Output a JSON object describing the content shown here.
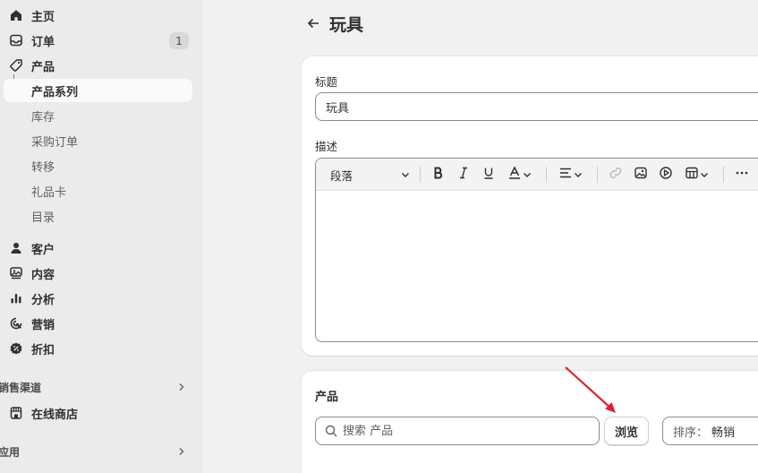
{
  "sidebar": {
    "home": "主页",
    "orders": "订单",
    "orders_badge": "1",
    "products": "产品",
    "collections": "产品系列",
    "inventory": "库存",
    "purchase_orders": "采购订单",
    "transfers": "转移",
    "gift_cards": "礼品卡",
    "catalogs": "目录",
    "customers": "客户",
    "content": "内容",
    "analytics": "分析",
    "marketing": "营销",
    "discounts": "折扣",
    "sales_channels": "销售渠道",
    "online_store": "在线商店",
    "apps": "应用"
  },
  "page": {
    "title": "玩具"
  },
  "details": {
    "title_label": "标题",
    "title_value": "玩具",
    "description_label": "描述",
    "paragraph_select": "段落"
  },
  "products_card": {
    "title": "产品",
    "search_placeholder": "搜索 产品",
    "browse": "浏览",
    "sort_label": "排序：",
    "sort_value": "畅销"
  },
  "colors": {
    "sidebar_bg": "#ebebeb",
    "page_bg": "#f1f1f1",
    "annotation_arrow": "#d9262c"
  }
}
